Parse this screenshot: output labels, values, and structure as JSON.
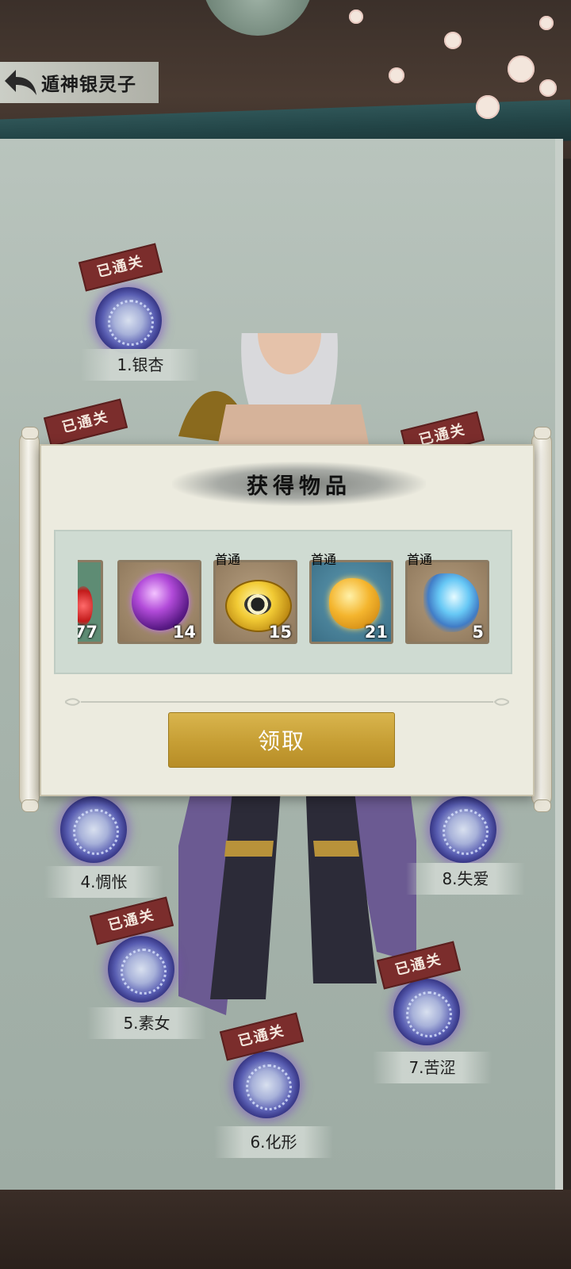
{
  "header": {
    "title": "遁神银灵子"
  },
  "stages": [
    {
      "label": "1.银杏",
      "stamp": "已通关"
    },
    {
      "label": "4.惆怅",
      "stamp": "已通关"
    },
    {
      "label": "5.素女",
      "stamp": "已通关"
    },
    {
      "label": "6.化形",
      "stamp": "已通关"
    },
    {
      "label": "7.苦涩",
      "stamp": "已通关"
    },
    {
      "label": "8.失爱",
      "stamp": "已通关"
    },
    {
      "stamp": "已通关"
    },
    {
      "stamp": "已通关"
    }
  ],
  "popup": {
    "title": "获得物品",
    "items": [
      {
        "icon": "red-gem-icon",
        "count": "77",
        "first_clear": ""
      },
      {
        "icon": "purple-flame-orb-icon",
        "count": "14",
        "first_clear": ""
      },
      {
        "icon": "taiji-gold-coin-icon",
        "count": "15",
        "first_clear": "首通"
      },
      {
        "icon": "gold-ingot-icon",
        "count": "21",
        "first_clear": "首通"
      },
      {
        "icon": "blue-spirit-icon",
        "count": "5",
        "first_clear": "首通"
      }
    ],
    "claim_label": "领取"
  },
  "colors": {
    "button_gold": "#c69e34",
    "stamp_red": "#7b2d2c",
    "paper": "#ecebdf",
    "tray": "#cfdbd2"
  }
}
